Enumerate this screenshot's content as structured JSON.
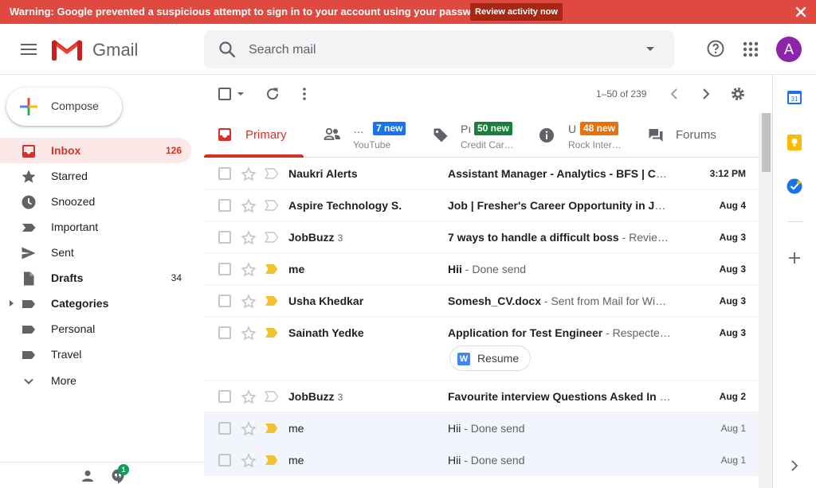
{
  "warning": {
    "text": "Warning: Google prevented a suspicious attempt to sign in to your account using your password.",
    "button": "Review activity now"
  },
  "header": {
    "app_name": "Gmail",
    "search_placeholder": "Search mail",
    "avatar_letter": "A"
  },
  "sidebar": {
    "compose": "Compose",
    "items": [
      {
        "label": "Inbox",
        "count": "126"
      },
      {
        "label": "Starred",
        "count": ""
      },
      {
        "label": "Snoozed",
        "count": ""
      },
      {
        "label": "Important",
        "count": ""
      },
      {
        "label": "Sent",
        "count": ""
      },
      {
        "label": "Drafts",
        "count": "34"
      },
      {
        "label": "Categories",
        "count": ""
      },
      {
        "label": "Personal",
        "count": ""
      },
      {
        "label": "Travel",
        "count": ""
      },
      {
        "label": "More",
        "count": ""
      }
    ],
    "hangouts_badge": "1"
  },
  "toolbar": {
    "pager": "1–50 of 239"
  },
  "tabs": [
    {
      "name": "Primary",
      "sub": "",
      "badge": ""
    },
    {
      "name": "…",
      "sub": "YouTube",
      "badge": "7 new",
      "badge_color": "#1a73e8"
    },
    {
      "name": "Pı",
      "sub": "Credit Car…",
      "badge": "50 new",
      "badge_color": "#188038"
    },
    {
      "name": "U",
      "sub": "Rock Inter…",
      "badge": "48 new",
      "badge_color": "#e8710a"
    },
    {
      "name": "Forums",
      "sub": "",
      "badge": ""
    }
  ],
  "emails": [
    {
      "sender": "Naukri Alerts",
      "thread": "",
      "subject": "Assistant Manager - Analytics - BFS | Cus…",
      "snippet": "",
      "date": "3:12 PM",
      "important": false,
      "read": false
    },
    {
      "sender": "Aspire Technology S.",
      "thread": "",
      "subject": "Job | Fresher's Career Opportunity in JAV…",
      "snippet": "",
      "date": "Aug 4",
      "important": false,
      "read": false
    },
    {
      "sender": "JobBuzz",
      "thread": "3",
      "subject": "7 ways to handle a difficult boss",
      "snippet": " - Review…",
      "date": "Aug 3",
      "important": false,
      "read": false
    },
    {
      "sender": "me",
      "thread": "",
      "subject": "Hii",
      "snippet": " - Done send",
      "date": "Aug 3",
      "important": true,
      "read": false
    },
    {
      "sender": "Usha Khedkar",
      "thread": "",
      "subject": "Somesh_CV.docx",
      "snippet": " - Sent from Mail for Win…",
      "date": "Aug 3",
      "important": true,
      "read": false
    },
    {
      "sender": "Sainath Yedke",
      "thread": "",
      "subject": "Application for Test Engineer",
      "snippet": " - Respected…",
      "date": "Aug 3",
      "important": true,
      "read": false,
      "attachment": "Resume",
      "attachment_icon": "W"
    },
    {
      "sender": "JobBuzz",
      "thread": "3",
      "subject": "Favourite interview Questions Asked In R…",
      "snippet": "",
      "date": "Aug 2",
      "important": false,
      "read": false
    },
    {
      "sender": "me",
      "thread": "",
      "subject": "Hii",
      "snippet": " - Done send",
      "date": "Aug 1",
      "important": true,
      "read": true
    },
    {
      "sender": "me",
      "thread": "",
      "subject": "Hii",
      "snippet": " - Done send",
      "date": "Aug 1",
      "important": true,
      "read": true
    }
  ],
  "right_panel": {
    "calendar_day": "31"
  },
  "colors": {
    "warning_bg": "#e0493f",
    "accent_red": "#d93025",
    "important_yellow": "#f2c232",
    "avatar": "#8e24aa"
  }
}
